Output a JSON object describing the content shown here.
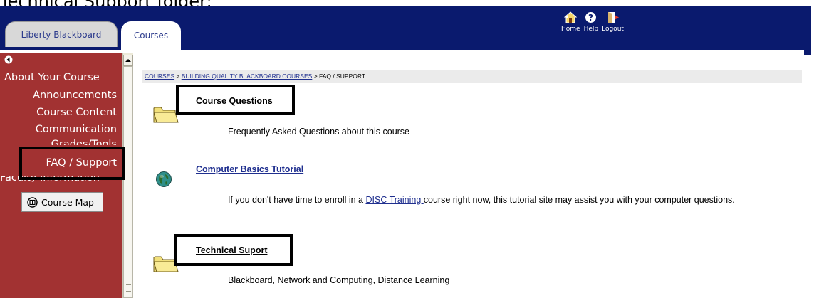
{
  "caption": "Technical Support folder:",
  "tabs": [
    {
      "label": "Liberty Blackboard"
    },
    {
      "label": "Courses"
    }
  ],
  "topnav": {
    "home": "Home",
    "help": "Help",
    "logout": "Logout"
  },
  "menu": {
    "items": [
      "About Your Course",
      "Announcements",
      "Course Content",
      "Communication",
      "Grades/Tools",
      "FAQ / Support",
      "Faculty Information"
    ],
    "course_map": "Course Map"
  },
  "breadcrumb": {
    "courses": "COURSES",
    "sep1": " > ",
    "course": "BUILDING QUALITY BLACKBOARD COURSES",
    "sep2": " > ",
    "current": "FAQ / SUPPORT"
  },
  "entries": [
    {
      "title": "Course Questions",
      "desc": "Frequently Asked Questions about this course"
    },
    {
      "title": "Computer Basics Tutorial",
      "desc_before": "If you don't have time to enroll in a ",
      "desc_link": "DISC Training ",
      "desc_after": "course right now, this tutorial site may assist you with your computer questions."
    },
    {
      "title": "Technical Suport",
      "desc": "Blackboard, Network and Computing, Distance Learning"
    }
  ],
  "colors": {
    "header": "#0a1a6e",
    "menu": "#a23232",
    "link": "#1f2f8f"
  }
}
